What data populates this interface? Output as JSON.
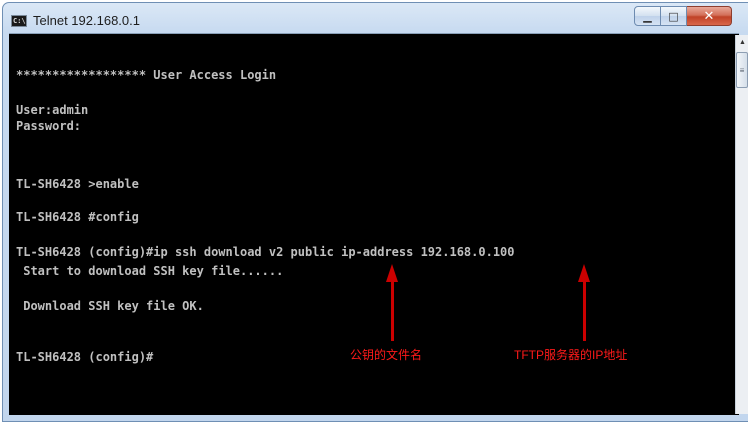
{
  "window": {
    "icon_text": "C:\\",
    "title": "Telnet 192.168.0.1",
    "controls": {
      "minimize": "▁",
      "maximize": "□",
      "close": "✕"
    }
  },
  "terminal": {
    "lines": [
      "****************** User Access Login",
      "User:admin",
      "Password:",
      "TL-SH6428 >enable",
      "TL-SH6428 #config",
      "TL-SH6428 (config)#ip ssh download v2 public ip-address 192.168.0.100",
      " Start to download SSH key file......",
      " Download SSH key file OK.",
      "TL-SH6428 (config)#"
    ]
  },
  "annotations": {
    "public_key_label": "公钥的文件名",
    "tftp_label": "TFTP服务器的IP地址"
  },
  "colors": {
    "annotation": "#ff1a1a",
    "arrow": "#cc0000",
    "terminal_bg": "#000000",
    "terminal_text": "#c0c0c0"
  }
}
